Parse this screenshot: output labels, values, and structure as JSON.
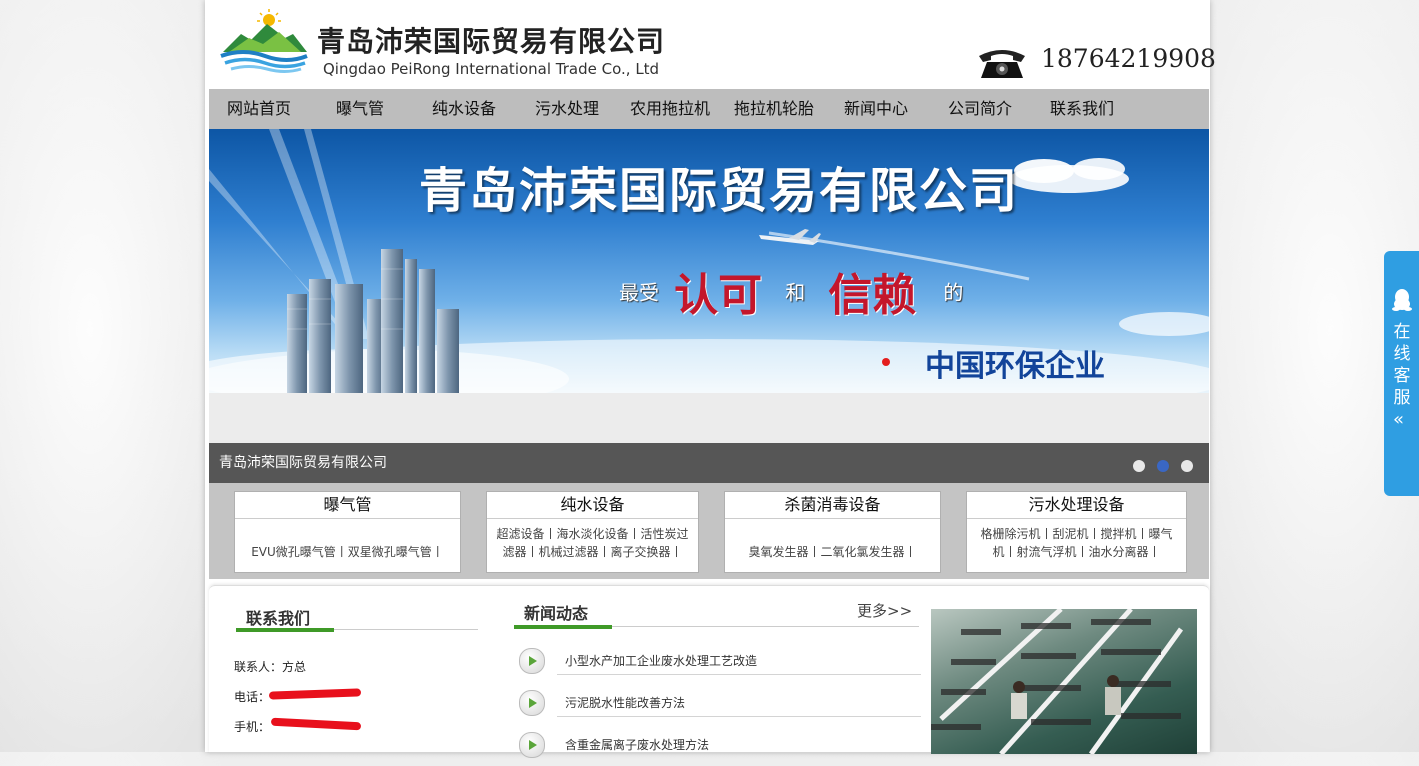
{
  "header": {
    "company_name_cn": "青岛沛荣国际贸易有限公司",
    "company_name_en": "Qingdao PeiRong International Trade Co., Ltd",
    "phone": "18764219908"
  },
  "nav": {
    "items": [
      {
        "label": "网站首页"
      },
      {
        "label": "曝气管"
      },
      {
        "label": "纯水设备"
      },
      {
        "label": "污水处理"
      },
      {
        "label": "农用拖拉机"
      },
      {
        "label": "拖拉机轮胎"
      },
      {
        "label": "新闻中心"
      },
      {
        "label": "公司简介"
      },
      {
        "label": "联系我们"
      }
    ]
  },
  "banner": {
    "title": "青岛沛荣国际贸易有限公司",
    "slogan": [
      "最受",
      "认可",
      "和",
      "信赖",
      "的"
    ],
    "enterprise": "中国环保企业",
    "caption": "青岛沛荣国际贸易有限公司",
    "slide_count": 3,
    "active_slide": 2
  },
  "categories": [
    {
      "title": "曝气管",
      "links": "EVU微孔曝气管丨双星微孔曝气管丨"
    },
    {
      "title": "纯水设备",
      "links": "超滤设备丨海水淡化设备丨活性炭过滤器丨机械过滤器丨离子交换器丨"
    },
    {
      "title": "杀菌消毒设备",
      "links": "臭氧发生器丨二氧化氯发生器丨"
    },
    {
      "title": "污水处理设备",
      "links": "格栅除污机丨刮泥机丨搅拌机丨曝气机丨射流气浮机丨油水分离器丨"
    }
  ],
  "contact": {
    "title": "联系我们",
    "person_label": "联系人：",
    "person": "方总",
    "tel_label": "电话：",
    "mobile_label": "手机："
  },
  "news": {
    "title": "新闻动态",
    "more": "更多>>",
    "items": [
      "小型水产加工企业废水处理工艺改造",
      "污泥脱水性能改善方法",
      "含重金属离子废水处理方法"
    ]
  },
  "service": {
    "label": "在线客服",
    "chevron": "«"
  },
  "colors": {
    "nav_bg": "#bdbdbd",
    "caption_bg": "#565656",
    "accent_green": "#3f9a28",
    "slogan_red": "#c4162b",
    "enterprise_blue": "#12449a",
    "service_blue": "#2f9ee2"
  }
}
